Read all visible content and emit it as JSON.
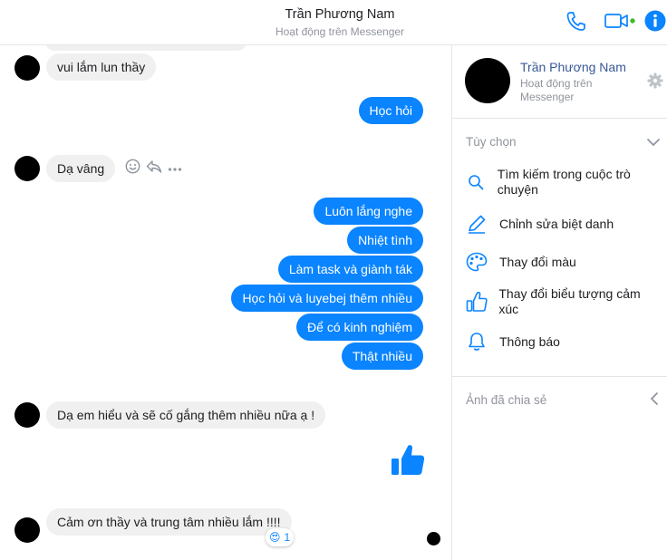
{
  "header": {
    "title": "Trần Phương Nam",
    "status": "Hoạt động trên Messenger",
    "accent": "#0a84ff",
    "icons": [
      "phone-icon",
      "video-camera-icon",
      "info-icon"
    ]
  },
  "chat": {
    "messages": [
      {
        "dir": "in",
        "text": "vui lắm lun thầy"
      },
      {
        "dir": "out",
        "text": "Học hỏi"
      },
      {
        "dir": "in",
        "text": "Dạ vâng"
      },
      {
        "dir": "out",
        "text": "Luôn lắng nghe"
      },
      {
        "dir": "out",
        "text": "Nhiệt tình"
      },
      {
        "dir": "out",
        "text": "Làm task và giành ták"
      },
      {
        "dir": "out",
        "text": "Học hỏi và luyebej thêm nhiều"
      },
      {
        "dir": "out",
        "text": "Để có kinh nghiệm"
      },
      {
        "dir": "out",
        "text": "Thật nhiều"
      },
      {
        "dir": "in",
        "text": "Dạ em hiểu và sẽ cố gắng thêm nhiều nữa ạ !"
      },
      {
        "dir": "out",
        "type": "like-sticker"
      },
      {
        "dir": "in",
        "text": "Cảm ơn thầy và trung tâm nhiều lắm !!!!"
      }
    ],
    "reaction": {
      "emoji": "😍",
      "count": "1"
    },
    "message_actions": [
      "emoji-icon",
      "reply-icon",
      "more-icon"
    ]
  },
  "sidebar": {
    "name": "Trần Phương Nam",
    "status": "Hoạt động trên Messenger",
    "options_title": "Tùy chọn",
    "options": [
      {
        "icon": "search-icon",
        "label": "Tìm kiếm trong cuộc trò chuyện"
      },
      {
        "icon": "pencil-icon",
        "label": "Chỉnh sửa biệt danh"
      },
      {
        "icon": "palette-icon",
        "label": "Thay đổi màu"
      },
      {
        "icon": "thumbs-up-icon",
        "label": "Thay đổi biểu tượng cảm xúc"
      },
      {
        "icon": "bell-icon",
        "label": "Thông báo"
      }
    ],
    "shared_title": "Ảnh đã chia sẻ"
  }
}
